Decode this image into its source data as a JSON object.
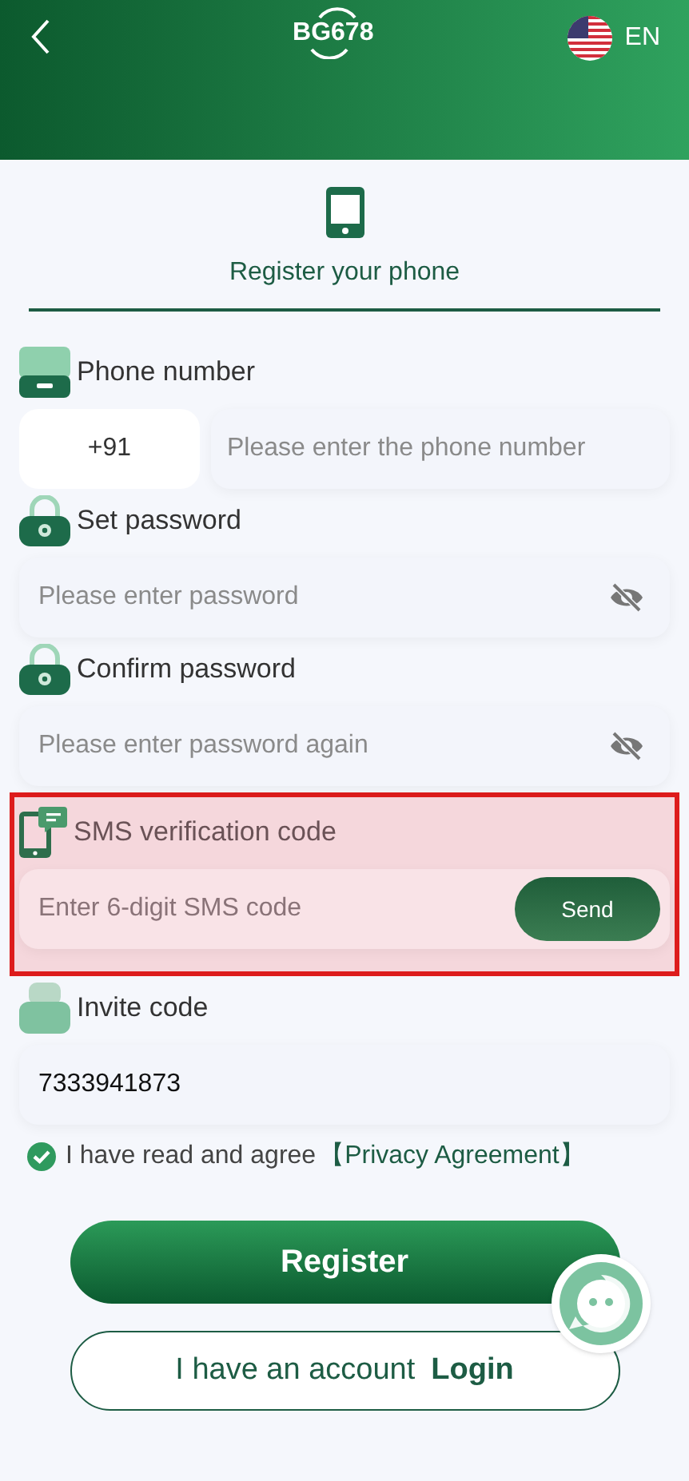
{
  "header": {
    "logo": "BG678",
    "language": "EN"
  },
  "tab": {
    "label": "Register your phone",
    "selected": true
  },
  "fields": [
    {
      "kind": "phone",
      "label": "Phone number",
      "prefix": "+91",
      "placeholder": "Please enter the phone number",
      "highlighted": false
    },
    {
      "kind": "password",
      "label": "Set password",
      "placeholder": "Please enter password",
      "highlighted": false
    },
    {
      "kind": "password",
      "label": "Confirm password",
      "placeholder": "Please enter password again",
      "highlighted": false
    },
    {
      "kind": "sms",
      "label": "SMS verification code",
      "placeholder": "Enter 6-digit SMS code",
      "button": "Send",
      "highlighted": true
    },
    {
      "kind": "invite",
      "label": "Invite code",
      "value": "7333941873",
      "highlighted": false
    }
  ],
  "agreement": {
    "checked": true,
    "text": "I have read and agree",
    "link": "【Privacy Agreement】"
  },
  "register_button": "Register",
  "login_button": {
    "text": "I have an account",
    "link": "Login"
  }
}
